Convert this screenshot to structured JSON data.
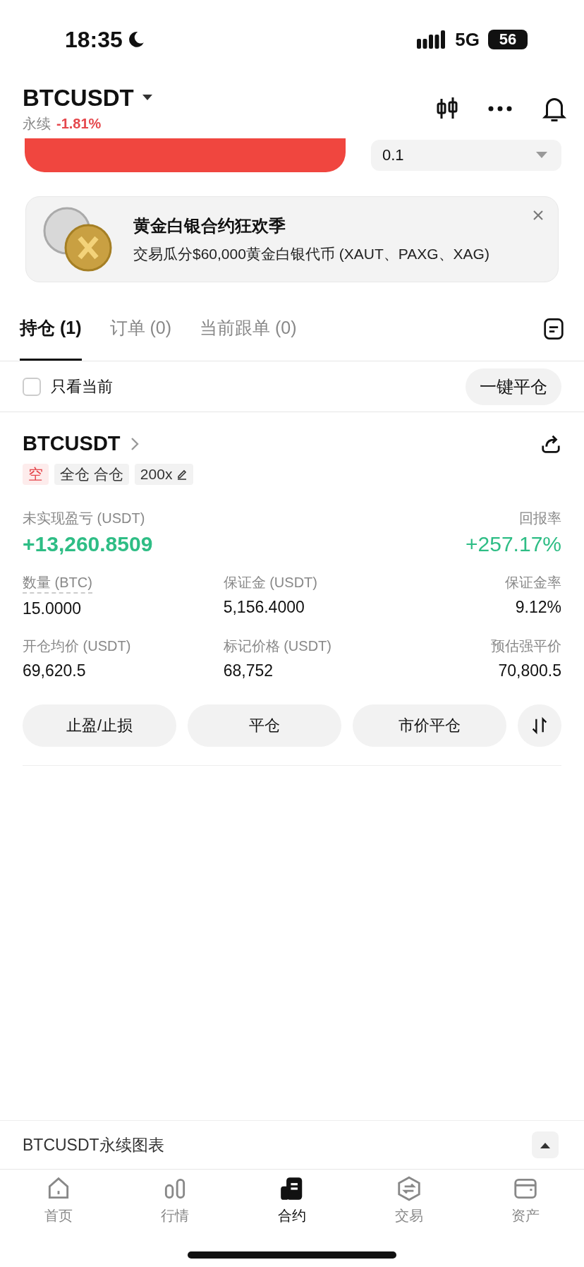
{
  "status_bar": {
    "time": "18:35",
    "network": "5G",
    "battery": "56"
  },
  "header": {
    "symbol": "BTCUSDT",
    "subtitle": "永续",
    "change": "-1.81%"
  },
  "order": {
    "quantity": "0.1"
  },
  "banner": {
    "title": "黄金白银合约狂欢季",
    "text": "交易瓜分$60,000黄金白银代币 (XAUT、PAXG、XAG)"
  },
  "tabs": [
    {
      "label": "持仓 (1)",
      "selected": true
    },
    {
      "label": "订单 (0)",
      "selected": false
    },
    {
      "label": "当前跟单 (0)",
      "selected": false
    }
  ],
  "filter": {
    "label": "只看当前",
    "checked": false,
    "close_all": "一键平仓"
  },
  "position": {
    "symbol": "BTCUSDT",
    "tags": [
      {
        "label": "空",
        "kind": "side"
      },
      {
        "label": "全仓 合仓",
        "kind": "plain"
      },
      {
        "label": "200x",
        "kind": "leverage"
      }
    ],
    "pnl_label": "未实现盈亏 (USDT)",
    "pnl": "+13,260.8509",
    "roe_label": "回报率",
    "roe": "+257.17%",
    "fields": [
      {
        "label": "数量 (BTC)",
        "value": "15.0000",
        "underlined": true
      },
      {
        "label": "保证金 (USDT)",
        "value": "5,156.4000",
        "underlined": false
      },
      {
        "label": "保证金率",
        "value": "9.12%",
        "underlined": false
      },
      {
        "label": "开仓均价 (USDT)",
        "value": "69,620.5",
        "underlined": false
      },
      {
        "label": "标记价格 (USDT)",
        "value": "68,752",
        "underlined": false
      },
      {
        "label": "预估强平价",
        "value": "70,800.5",
        "underlined": false
      }
    ],
    "actions": [
      "止盈/止损",
      "平仓",
      "市价平仓"
    ]
  },
  "chart_bar": {
    "label": "BTCUSDT永续图表"
  },
  "nav": [
    {
      "label": "首页",
      "kind": "home",
      "selected": false
    },
    {
      "label": "行情",
      "kind": "market",
      "selected": false
    },
    {
      "label": "合约",
      "kind": "futures",
      "selected": true
    },
    {
      "label": "交易",
      "kind": "trade",
      "selected": false
    },
    {
      "label": "资产",
      "kind": "assets",
      "selected": false
    }
  ]
}
